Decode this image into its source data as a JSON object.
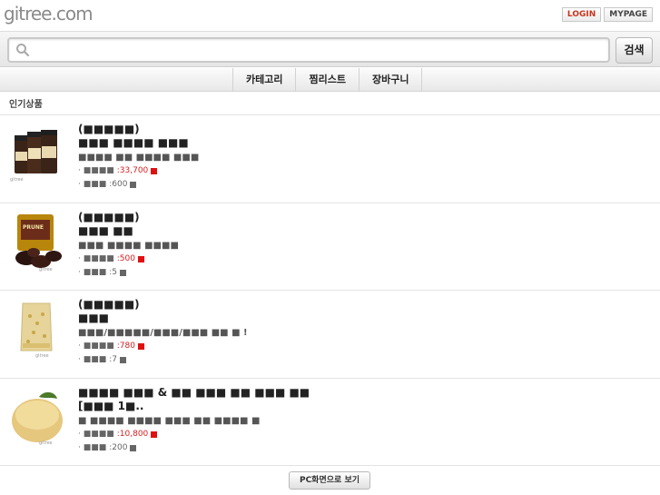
{
  "header": {
    "logo": "gitree.com",
    "login_label": "LOGIN",
    "mypage_label": "MYPAGE"
  },
  "search": {
    "placeholder": "",
    "button_label": "검색",
    "icon": "search-icon"
  },
  "nav": {
    "items": [
      {
        "label": "카테고리"
      },
      {
        "label": "찜리스트"
      },
      {
        "label": "장바구니"
      }
    ]
  },
  "section": {
    "title": "인기상품"
  },
  "products": [
    {
      "name": "(■■■■■)\n■■■ ■■■■ ■■■",
      "desc": "■■■■ ■■ ■■■■ ■■■",
      "price_label": "· ■■■■",
      "price": ":33,700",
      "point_label": "· ■■■",
      "point": ":600",
      "colors": {
        "price_mark": "#e01010"
      }
    },
    {
      "name": "(■■■■■)\n■■■ ■■",
      "desc": "■■■ ■■■■ ■■■■",
      "price_label": "· ■■■■",
      "price": ":500",
      "point_label": "· ■■■",
      "point": ":5"
    },
    {
      "name": "(■■■■■)\n■■■",
      "desc": "■■■/■■■■■/■■■/■■■ ■■ ■ !",
      "price_label": "· ■■■■",
      "price": ":780",
      "point_label": "· ■■■",
      "point": ":7"
    },
    {
      "name": "■■■■ ■■■ & ■■ ■■■ ■■ ■■■ ■■\n[■■■ 1■..",
      "desc": "■ ■■■■ ■■■■ ■■■ ■■ ■■■■ ■",
      "price_label": "· ■■■■",
      "price": ":10,800",
      "point_label": "· ■■■",
      "point": ":200"
    }
  ],
  "footer": {
    "pc_view_label": "PC화면으로 보기"
  }
}
